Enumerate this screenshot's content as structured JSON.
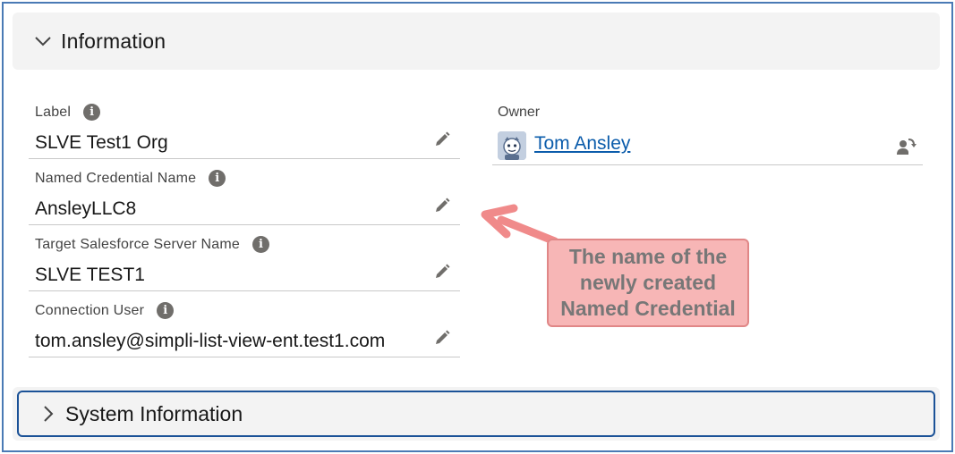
{
  "information_section": {
    "title": "Information",
    "chevron_icon": "chevron-down-icon"
  },
  "fields": [
    {
      "label": "Label",
      "value": "SLVE Test1 Org"
    },
    {
      "label": "Named Credential Name",
      "value": "AnsleyLLC8"
    },
    {
      "label": "Target Salesforce Server Name",
      "value": "SLVE TEST1"
    },
    {
      "label": "Connection User",
      "value": "tom.ansley@simpli-list-view-ent.test1.com"
    }
  ],
  "owner": {
    "label": "Owner",
    "name": "Tom Ansley",
    "change_icon": "change-owner-icon"
  },
  "annotation": {
    "line1": "The name of the",
    "line2": "newly created",
    "line3": "Named Credential",
    "fill_color": "#f7b6b6",
    "arrow_color": "#f08a8a"
  },
  "system_section": {
    "title": "System Information",
    "chevron_icon": "chevron-right-icon"
  },
  "colors": {
    "link": "#0b5cab",
    "frame_border": "#4a7ab5",
    "focus_border": "#1b5297"
  }
}
